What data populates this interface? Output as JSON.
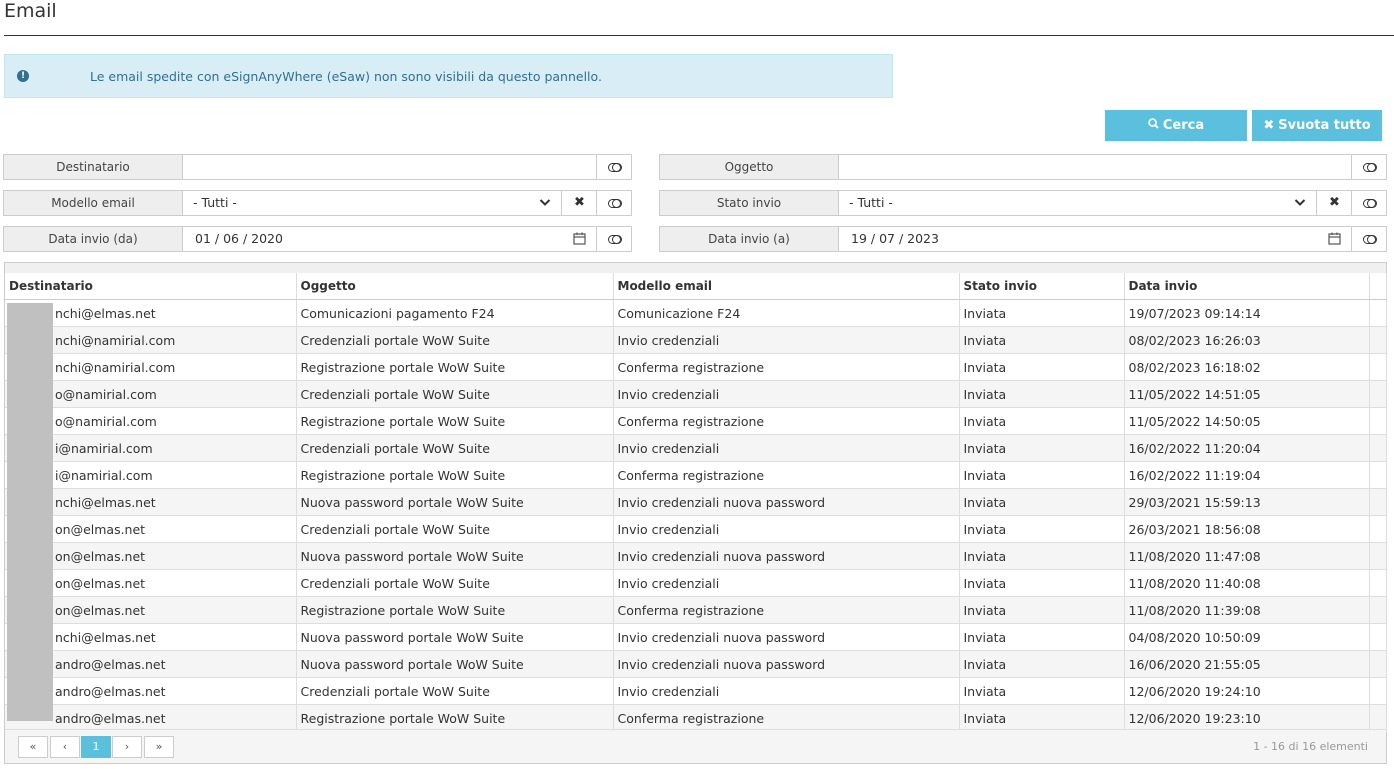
{
  "page": {
    "title": "Email"
  },
  "info": {
    "text": "Le email spedite con eSignAnyWhere (eSaw) non sono visibili da questo pannello."
  },
  "buttons": {
    "search": "Cerca",
    "clear": "Svuota tutto"
  },
  "filters": {
    "destinatario": {
      "label": "Destinatario",
      "value": ""
    },
    "oggetto": {
      "label": "Oggetto",
      "value": ""
    },
    "modello": {
      "label": "Modello email",
      "value": "- Tutti -"
    },
    "stato": {
      "label": "Stato invio",
      "value": "- Tutti -"
    },
    "data_da": {
      "label": "Data invio (da)",
      "value": "01 / 06 / 2020"
    },
    "data_a": {
      "label": "Data invio (a)",
      "value": "19 / 07 / 2023"
    }
  },
  "table": {
    "columns": [
      "Destinatario",
      "Oggetto",
      "Modello email",
      "Stato invio",
      "Data invio"
    ],
    "rows": [
      [
        "nchi@elmas.net",
        "Comunicazioni pagamento F24",
        "Comunicazione F24",
        "Inviata",
        "19/07/2023 09:14:14"
      ],
      [
        "nchi@namirial.com",
        "Credenziali portale WoW Suite",
        "Invio credenziali",
        "Inviata",
        "08/02/2023 16:26:03"
      ],
      [
        "nchi@namirial.com",
        "Registrazione portale WoW Suite",
        "Conferma registrazione",
        "Inviata",
        "08/02/2023 16:18:02"
      ],
      [
        "o@namirial.com",
        "Credenziali portale WoW Suite",
        "Invio credenziali",
        "Inviata",
        "11/05/2022 14:51:05"
      ],
      [
        "o@namirial.com",
        "Registrazione portale WoW Suite",
        "Conferma registrazione",
        "Inviata",
        "11/05/2022 14:50:05"
      ],
      [
        "i@namirial.com",
        "Credenziali portale WoW Suite",
        "Invio credenziali",
        "Inviata",
        "16/02/2022 11:20:04"
      ],
      [
        "i@namirial.com",
        "Registrazione portale WoW Suite",
        "Conferma registrazione",
        "Inviata",
        "16/02/2022 11:19:04"
      ],
      [
        "nchi@elmas.net",
        "Nuova password portale WoW Suite",
        "Invio credenziali nuova password",
        "Inviata",
        "29/03/2021 15:59:13"
      ],
      [
        "on@elmas.net",
        "Credenziali portale WoW Suite",
        "Invio credenziali",
        "Inviata",
        "26/03/2021 18:56:08"
      ],
      [
        "on@elmas.net",
        "Nuova password portale WoW Suite",
        "Invio credenziali nuova password",
        "Inviata",
        "11/08/2020 11:47:08"
      ],
      [
        "on@elmas.net",
        "Credenziali portale WoW Suite",
        "Invio credenziali",
        "Inviata",
        "11/08/2020 11:40:08"
      ],
      [
        "on@elmas.net",
        "Registrazione portale WoW Suite",
        "Conferma registrazione",
        "Inviata",
        "11/08/2020 11:39:08"
      ],
      [
        "nchi@elmas.net",
        "Nuova password portale WoW Suite",
        "Invio credenziali nuova password",
        "Inviata",
        "04/08/2020 10:50:09"
      ],
      [
        "andro@elmas.net",
        "Nuova password portale WoW Suite",
        "Invio credenziali nuova password",
        "Inviata",
        "16/06/2020 21:55:05"
      ],
      [
        "andro@elmas.net",
        "Credenziali portale WoW Suite",
        "Invio credenziali",
        "Inviata",
        "12/06/2020 19:24:10"
      ],
      [
        "andro@elmas.net",
        "Registrazione portale WoW Suite",
        "Conferma registrazione",
        "Inviata",
        "12/06/2020 19:23:10"
      ]
    ]
  },
  "pager": {
    "first": "«",
    "prev": "‹",
    "current": "1",
    "next": "›",
    "last": "»",
    "info": "1 - 16 di 16 elementi"
  },
  "colors": {
    "accent": "#5bc0de",
    "info_bg": "#d9edf7",
    "info_text": "#31708f"
  }
}
